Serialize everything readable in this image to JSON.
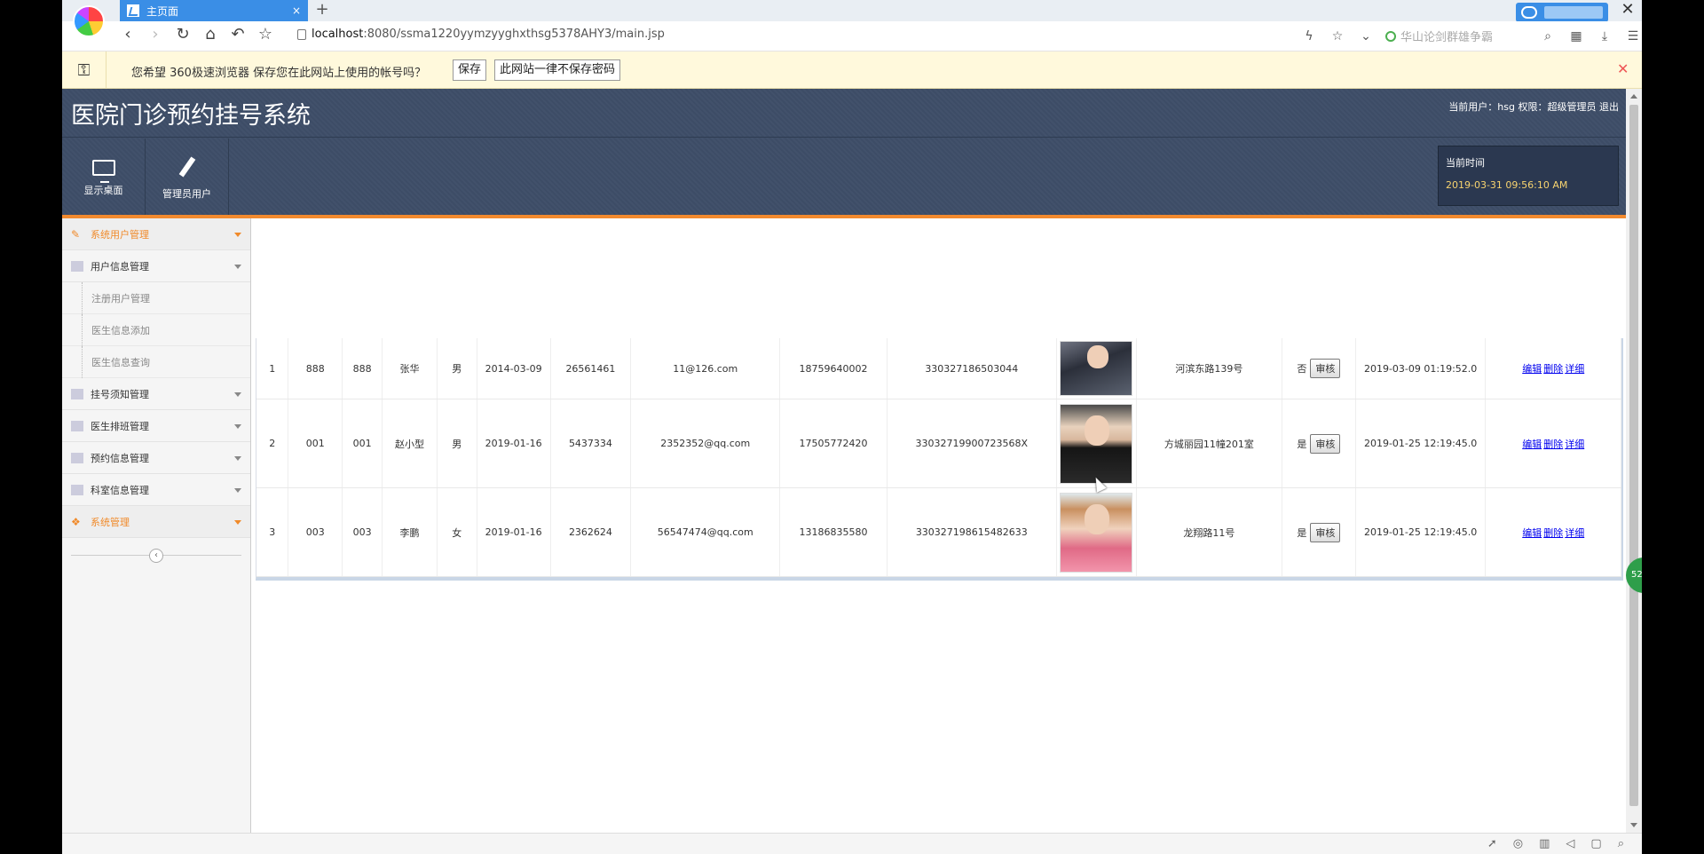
{
  "browser": {
    "tab_title": "主页面",
    "tab_close": "×",
    "new_tab": "+",
    "url_host": "localhost",
    "url_path": ":8080/ssma1220yymzyyghxthsg5378AHY3/main.jsp",
    "search_hint": "华山论剑群雄争霸",
    "window_close": "✕"
  },
  "password_bar": {
    "message": "您希望 360极速浏览器 保存您在此网站上使用的帐号吗？",
    "save_label": "保存",
    "never_label": "此网站一律不保存密码",
    "close": "✕"
  },
  "header": {
    "title": "医院门诊预约挂号系统",
    "user_info": "当前用户：hsg 权限：超级管理员  退出",
    "toolbar": [
      {
        "label": "显示桌面",
        "icon": "monitor-icon"
      },
      {
        "label": "管理员用户",
        "icon": "pencil-icon"
      }
    ],
    "clock_label": "当前时间",
    "clock_value": "2019-03-31 09:56:10 AM"
  },
  "colors": {
    "accent_orange": "#f28a2e",
    "header_bg": "#3e4e68",
    "clock_text": "#f7d36f"
  },
  "sidebar": {
    "items": [
      {
        "label": "系统用户管理",
        "active": true
      },
      {
        "label": "用户信息管理",
        "active": false
      },
      {
        "label": "注册用户管理",
        "sub": true
      },
      {
        "label": "医生信息添加",
        "sub": true
      },
      {
        "label": "医生信息查询",
        "sub": true
      },
      {
        "label": "挂号须知管理",
        "active": false
      },
      {
        "label": "医生排班管理",
        "active": false
      },
      {
        "label": "预约信息管理",
        "active": false
      },
      {
        "label": "科室信息管理",
        "active": false
      },
      {
        "label": "系统管理",
        "active": true
      }
    ],
    "collapse": "‹"
  },
  "table": {
    "rows": [
      {
        "no": "1",
        "account": "888",
        "password": "888",
        "name": "张华",
        "gender": "男",
        "birth": "2014-03-09",
        "qq": "26561461",
        "email": "11@126.com",
        "phone": "18759640002",
        "idcard": "330327186503044",
        "address": "河滨东路139号",
        "audited": "否",
        "audit_btn": "审核",
        "added": "2019-03-09 01:19:52.0",
        "edit": "编辑",
        "delete": "删除",
        "detail": "详细"
      },
      {
        "no": "2",
        "account": "001",
        "password": "001",
        "name": "赵小型",
        "gender": "男",
        "birth": "2019-01-16",
        "qq": "5437334",
        "email": "2352352@qq.com",
        "phone": "17505772420",
        "idcard": "33032719900723568X",
        "address": "方城丽园11幢201室",
        "audited": "是",
        "audit_btn": "审核",
        "added": "2019-01-25 12:19:45.0",
        "edit": "编辑",
        "delete": "删除",
        "detail": "详细"
      },
      {
        "no": "3",
        "account": "003",
        "password": "003",
        "name": "李鹏",
        "gender": "女",
        "birth": "2019-01-16",
        "qq": "2362624",
        "email": "56547474@qq.com",
        "phone": "13186835580",
        "idcard": "330327198615482633",
        "address": "龙翔路11号",
        "audited": "是",
        "audit_btn": "审核",
        "added": "2019-01-25 12:19:45.0",
        "edit": "编辑",
        "delete": "删除",
        "detail": "详细"
      }
    ]
  },
  "badge": "52"
}
